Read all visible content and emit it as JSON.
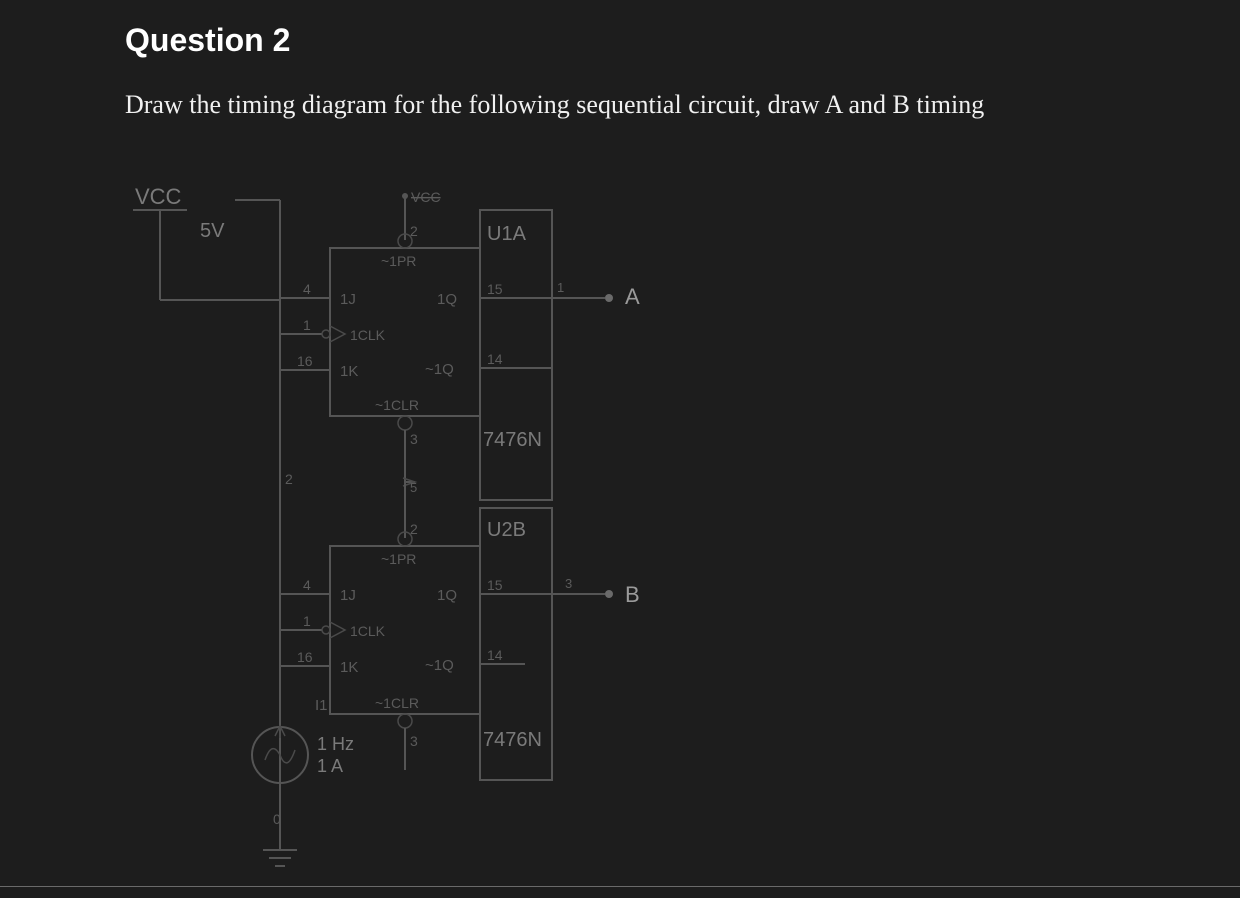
{
  "heading": "Question 2",
  "prompt": "Draw the timing diagram for the following sequential circuit, draw A and B timing",
  "circuit": {
    "supply": {
      "label": "VCC",
      "voltage": "5V",
      "top_node": "VCC"
    },
    "source": {
      "name": "I1",
      "freq": "1 Hz",
      "amp": "1 A"
    },
    "outputs": {
      "a": "A",
      "b": "B"
    },
    "ff": [
      {
        "ref": "U1A",
        "part": "7476N",
        "pins": {
          "pr": {
            "name": "~1PR",
            "num": "2"
          },
          "j": {
            "name": "1J",
            "num": "4"
          },
          "clk": {
            "name": "1CLK",
            "num": "1"
          },
          "k": {
            "name": "1K",
            "num": "16"
          },
          "clr": {
            "name": "~1CLR",
            "num": "3"
          },
          "q": {
            "name": "1Q",
            "num": "15"
          },
          "qn": {
            "name": "~1Q",
            "num": "14"
          }
        },
        "out_pin_external": "1"
      },
      {
        "ref": "U2B",
        "part": "7476N",
        "pins": {
          "pr": {
            "name": "~1PR",
            "num": "2"
          },
          "j": {
            "name": "1J",
            "num": "4"
          },
          "clk": {
            "name": "1CLK",
            "num": "1"
          },
          "k": {
            "name": "1K",
            "num": "16"
          },
          "clr": {
            "name": "~1CLR",
            "num": "3"
          },
          "q": {
            "name": "1Q",
            "num": "15"
          },
          "qn": {
            "name": "~1Q",
            "num": "14"
          }
        },
        "out_pin_external": "3"
      }
    ],
    "mid_wire_label": "2",
    "bottom_node": "0",
    "stub_5": "5"
  }
}
